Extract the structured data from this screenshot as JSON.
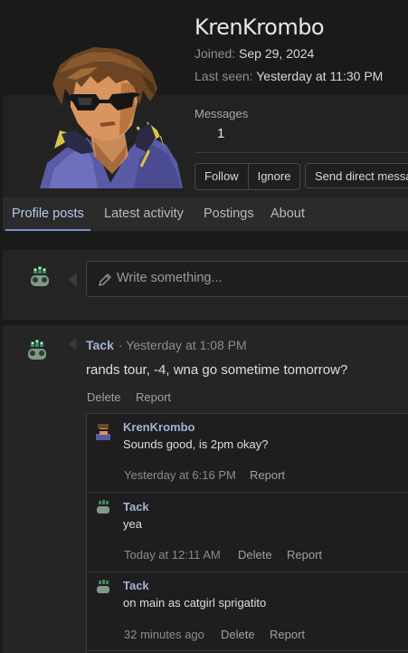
{
  "profile": {
    "username": "KrenKrombo",
    "joined_label": "Joined:",
    "joined_value": "Sep 29, 2024",
    "last_seen_label": "Last seen:",
    "last_seen_value": "Yesterday at 11:30 PM",
    "messages_label": "Messages",
    "messages_value": "1",
    "follow_label": "Follow",
    "ignore_label": "Ignore",
    "dm_label": "Send direct message",
    "avatar_icon": "pixel-art-man-sunglasses-avatar"
  },
  "tabs": [
    {
      "label": "Profile posts",
      "active": true
    },
    {
      "label": "Latest activity",
      "active": false
    },
    {
      "label": "Postings",
      "active": false
    },
    {
      "label": "About",
      "active": false
    }
  ],
  "composer": {
    "placeholder": "Write something...",
    "icon": "pencil-icon"
  },
  "post": {
    "author": "Tack",
    "time": "· Yesterday at 1:08 PM",
    "text": "rands tour, -4, wna go sometime tomorrow?",
    "delete_label": "Delete",
    "report_label": "Report"
  },
  "comments": [
    {
      "author": "KrenKrombo",
      "text": "Sounds good, is 2pm okay?",
      "time": "Yesterday at 6:16 PM",
      "actions": [
        "Report"
      ]
    },
    {
      "author": "Tack",
      "text": "yea",
      "time": "Today at 12:11 AM",
      "actions": [
        "Delete",
        "Report"
      ]
    },
    {
      "author": "Tack",
      "text": "on main as catgirl sprigatito",
      "time": "32 minutes ago",
      "actions": [
        "Delete",
        "Report"
      ]
    }
  ],
  "colors": {
    "accent": "#7a8fc8",
    "username": "#a4b2d5",
    "background": "#1b1b1c"
  }
}
